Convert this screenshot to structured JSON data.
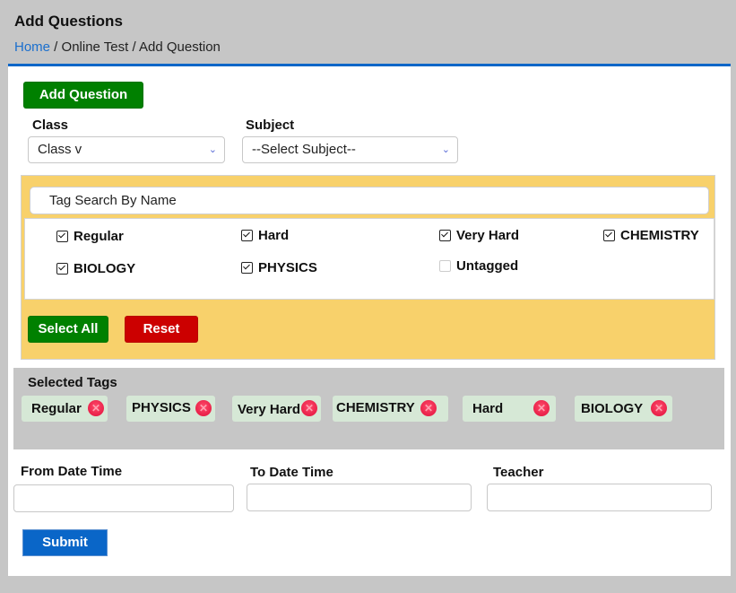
{
  "header": {
    "title": "Add Questions",
    "breadcrumb": {
      "home": "Home",
      "separator1": " / ",
      "section": "Online Test",
      "separator2": " / ",
      "current": "Add Question"
    }
  },
  "toolbar": {
    "add_question_label": "Add Question"
  },
  "filters": {
    "class_label": "Class",
    "class_value": "Class v",
    "subject_label": "Subject",
    "subject_value": "--Select Subject--"
  },
  "tags": {
    "search_placeholder": "Tag Search By Name",
    "items": [
      {
        "label": "Regular",
        "checked": true
      },
      {
        "label": "Hard",
        "checked": true
      },
      {
        "label": "Very Hard",
        "checked": true
      },
      {
        "label": "CHEMISTRY",
        "checked": true
      },
      {
        "label": "BIOLOGY",
        "checked": true
      },
      {
        "label": "PHYSICS",
        "checked": true
      },
      {
        "label": "Untagged",
        "checked": false
      }
    ],
    "select_all_label": "Select All",
    "reset_label": "Reset"
  },
  "selected_tags": {
    "title": "Selected Tags",
    "items": [
      "Regular",
      "PHYSICS",
      "Very Hard",
      "CHEMISTRY",
      "Hard",
      "BIOLOGY"
    ],
    "remove_icon": "close-circle-icon"
  },
  "form": {
    "from_label": "From Date Time",
    "from_value": "",
    "to_label": "To Date Time",
    "to_value": "",
    "teacher_label": "Teacher",
    "teacher_value": "",
    "submit_label": "Submit"
  },
  "colors": {
    "primary_blue": "#0a66c8",
    "green": "#008000",
    "red": "#cc0000",
    "tag_panel": "#f8d16b",
    "chip_bg": "#d6e8d6",
    "page_bg": "#c6c6c6"
  }
}
